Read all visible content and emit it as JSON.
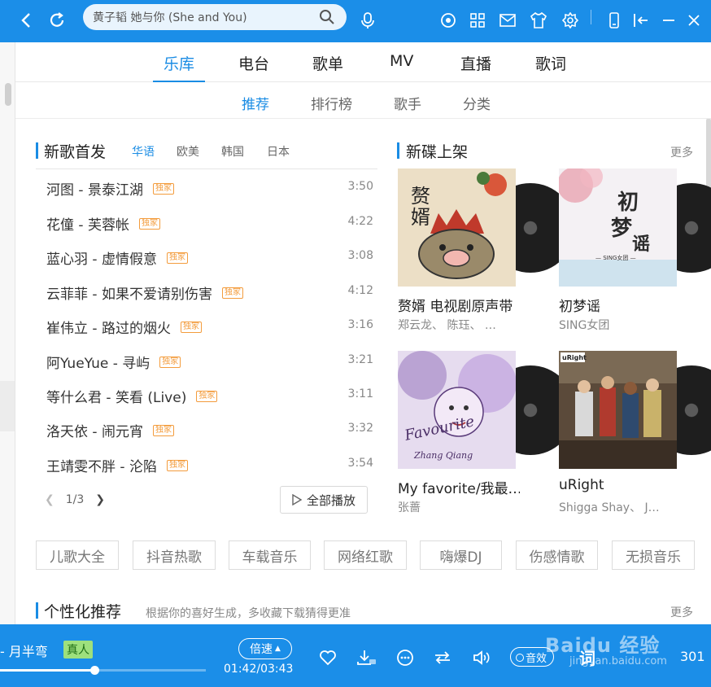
{
  "search": {
    "value": "黄子韬 她与你 (She and You)"
  },
  "main_tabs": [
    "乐库",
    "电台",
    "歌单",
    "MV",
    "直播",
    "歌词"
  ],
  "sub_tabs": [
    "推荐",
    "排行榜",
    "歌手",
    "分类"
  ],
  "new_songs": {
    "title": "新歌首发",
    "lang_tabs": [
      "华语",
      "欧美",
      "韩国",
      "日本"
    ],
    "songs": [
      {
        "name": "河图 - 景泰江湖",
        "badge": "独家",
        "duration": "3:50"
      },
      {
        "name": "花僮 - 芙蓉帐",
        "badge": "独家",
        "duration": "4:22"
      },
      {
        "name": "蓝心羽 - 虚情假意",
        "badge": "独家",
        "duration": "3:08"
      },
      {
        "name": "云菲菲 - 如果不爱请别伤害",
        "badge": "独家",
        "duration": "4:12"
      },
      {
        "name": "崔伟立 - 路过的烟火",
        "badge": "独家",
        "duration": "3:16"
      },
      {
        "name": "阿YueYue - 寻屿",
        "badge": "独家",
        "duration": "3:21"
      },
      {
        "name": "等什么君 - 笑看 (Live)",
        "badge": "独家",
        "duration": "3:11"
      },
      {
        "name": "洛天依 - 闹元宵",
        "badge": "独家",
        "duration": "3:32"
      },
      {
        "name": "王靖雯不胖 - 沦陷",
        "badge": "独家",
        "duration": "3:54"
      }
    ],
    "page": "1/3",
    "play_all": "全部播放"
  },
  "new_albums": {
    "title": "新碟上架",
    "more": "更多",
    "albums": [
      {
        "title": "赘婿 电视剧原声带",
        "artist": "郑云龙、 陈珏、 …",
        "cover_text": "赘婿"
      },
      {
        "title": "初梦谣",
        "artist": "SING女团",
        "cover_text": "初梦谣"
      },
      {
        "title": "My favorite/我最…",
        "artist": "张蔷",
        "cover_text": "Favourite"
      },
      {
        "title": "uRight",
        "artist": "Shigga Shay、 J…",
        "cover_text": "uRight"
      }
    ]
  },
  "tags": [
    "儿歌大全",
    "抖音热歌",
    "车载音乐",
    "网络红歌",
    "嗨爆DJ",
    "伤感情歌",
    "无损音乐"
  ],
  "personal": {
    "title": "个性化推荐",
    "subtitle": "根据你的喜好生成，多收藏下载猜得更准",
    "more": "更多"
  },
  "player": {
    "song": "- 月半弯",
    "badge": "真人",
    "speed": "倍速",
    "time": "01:42/03:43",
    "progress": 0.46,
    "effect": "音效",
    "lyric": "词",
    "count": "301",
    "watermark": "Baidu 经验",
    "watermark_url": "jingyan.baidu.com"
  },
  "colors": {
    "accent": "#1a8ce4",
    "topbar": "#1b8ee8",
    "badge": "#f39c3d"
  }
}
